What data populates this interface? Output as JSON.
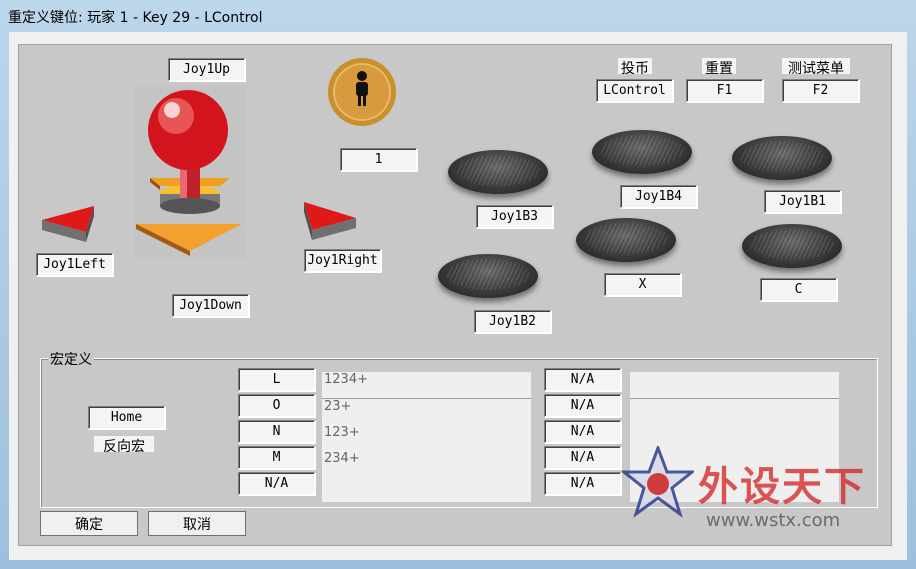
{
  "window": {
    "title": "重定义键位: 玩家 1 - Key 29 - LControl"
  },
  "joystick": {
    "up_label": "Joy1Up",
    "down_label": "Joy1Down",
    "left_label": "Joy1Left",
    "right_label": "Joy1Right"
  },
  "coin": {
    "value": "1"
  },
  "top_controls": {
    "coin_title": "投币",
    "coin_value": "LControl",
    "reset_title": "重置",
    "reset_value": "F1",
    "menu_title": "测试菜单",
    "menu_value": "F2"
  },
  "buttons": {
    "b3": "Joy1B3",
    "b4": "Joy1B4",
    "b1": "Joy1B1",
    "b2": "Joy1B2",
    "x": "X",
    "c": "C"
  },
  "macro": {
    "group_title": "宏定义",
    "home_value": "Home",
    "reverse_label": "反向宏",
    "keys": [
      "L",
      "O",
      "N",
      "M",
      "N/A"
    ],
    "sequences": [
      "1234+",
      "23+",
      "123+",
      "234+"
    ],
    "right_keys": [
      "N/A",
      "N/A",
      "N/A",
      "N/A",
      "N/A"
    ]
  },
  "footer": {
    "ok": "确定",
    "cancel": "取消"
  },
  "watermark": {
    "text": "外设天下",
    "url": "www.wstx.com"
  },
  "colors": {
    "panel": "#c8c8c8",
    "accent_red": "#e02020"
  }
}
